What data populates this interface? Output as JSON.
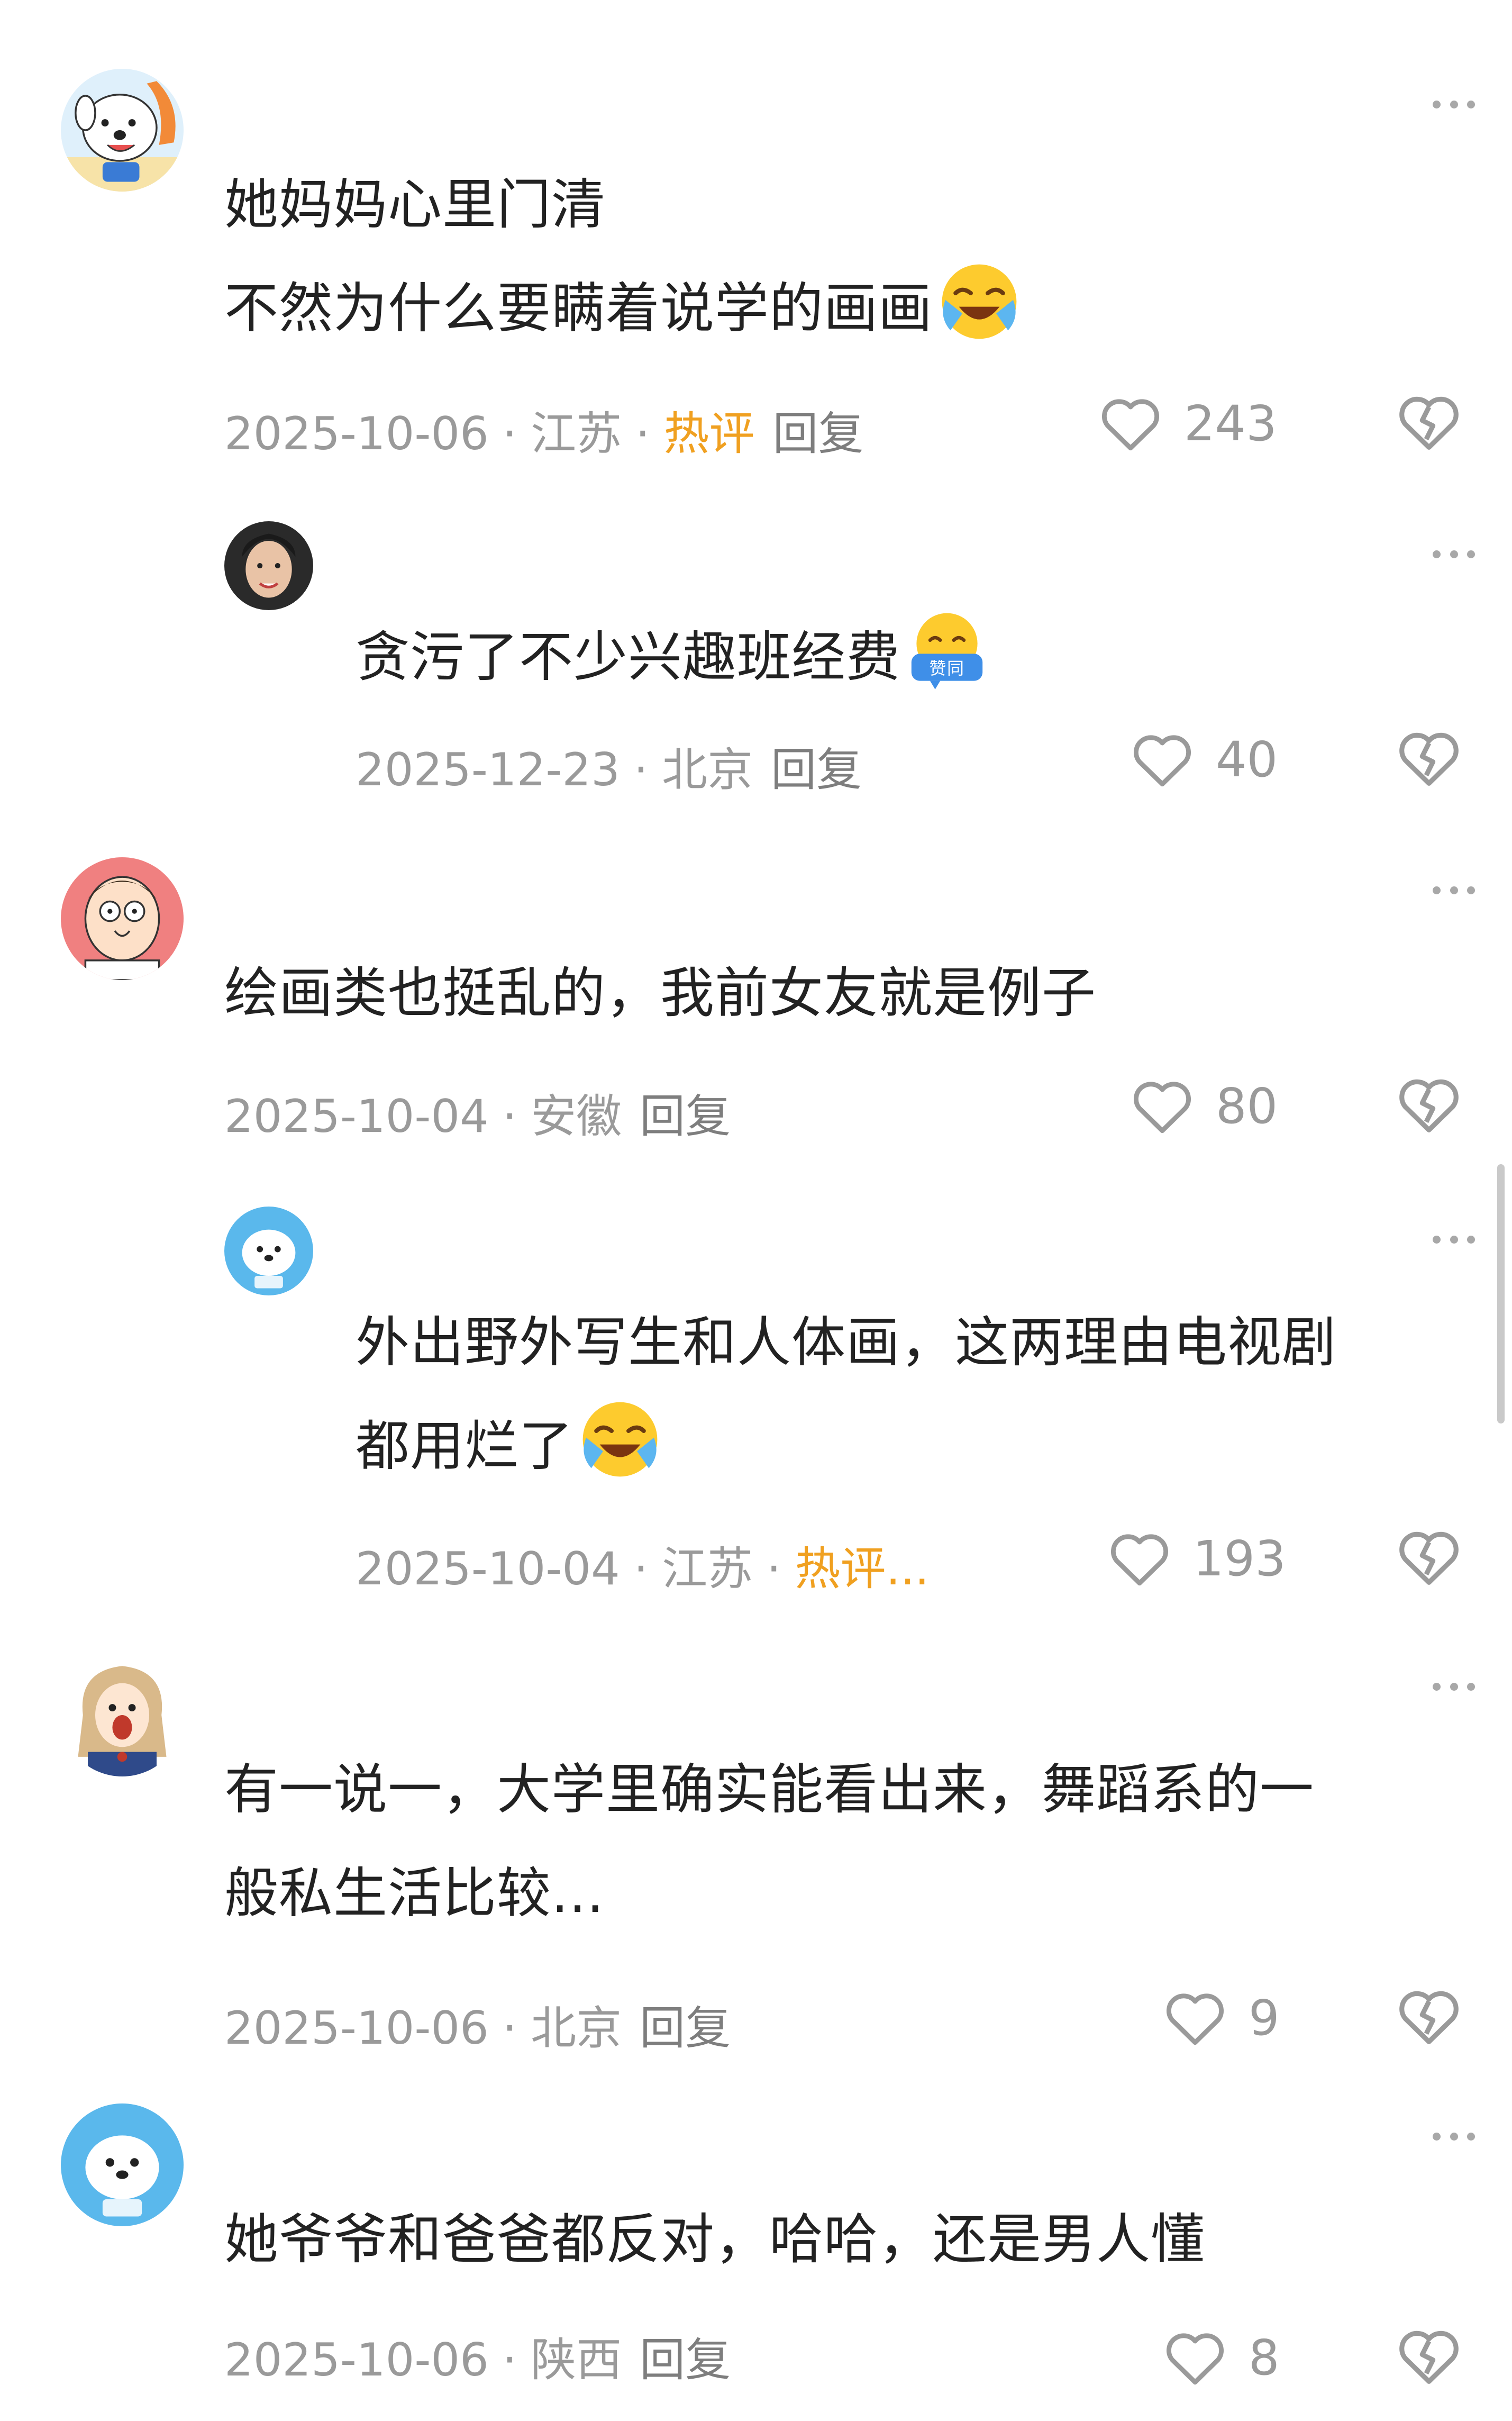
{
  "comments": [
    {
      "text_lines": [
        "她妈妈心里门清",
        "不然为什么要瞒着说学的画画"
      ],
      "emoji": "crying-laughing-emoji",
      "date": "2025-10-06",
      "location": "江苏",
      "hot_label": "热评",
      "reply_label": "回复",
      "likes": "243",
      "avatar": "white-dog-avatar"
    },
    {
      "text_lines": [
        "贪污了不少兴趣班经费"
      ],
      "emoji": "agree-emoji",
      "emoji_text": "赞同",
      "date": "2025-12-23",
      "location": "北京",
      "reply_label": "回复",
      "likes": "40",
      "avatar": "woman-portrait-avatar"
    },
    {
      "text_lines": [
        "绘画类也挺乱的，我前女友就是例子"
      ],
      "date": "2025-10-04",
      "location": "安徽",
      "reply_label": "回复",
      "likes": "80",
      "avatar": "cartoon-man-avatar"
    },
    {
      "text_lines": [
        "外出野外写生和人体画，这两理由电视剧",
        "都用烂了"
      ],
      "emoji": "crying-laughing-emoji",
      "date": "2025-10-04",
      "location": "江苏",
      "hot_label": "热评...",
      "likes": "193",
      "avatar": "blue-dog-avatar"
    },
    {
      "text_lines": [
        "有一说一，大学里确实能看出来，舞蹈系的一",
        "般私生活比较..."
      ],
      "date": "2025-10-06",
      "location": "北京",
      "reply_label": "回复",
      "likes": "9",
      "avatar": "cartoon-girl-avatar"
    },
    {
      "text_lines": [
        "她爷爷和爸爸都反对，哈哈，还是男人懂"
      ],
      "date": "2025-10-06",
      "location": "陕西",
      "reply_label": "回复",
      "likes": "8",
      "avatar": "blue-dog-avatar"
    }
  ],
  "separator": "·",
  "colors": {
    "hot": "#f0a020",
    "meta": "#9a9a9a",
    "text": "#222222"
  }
}
